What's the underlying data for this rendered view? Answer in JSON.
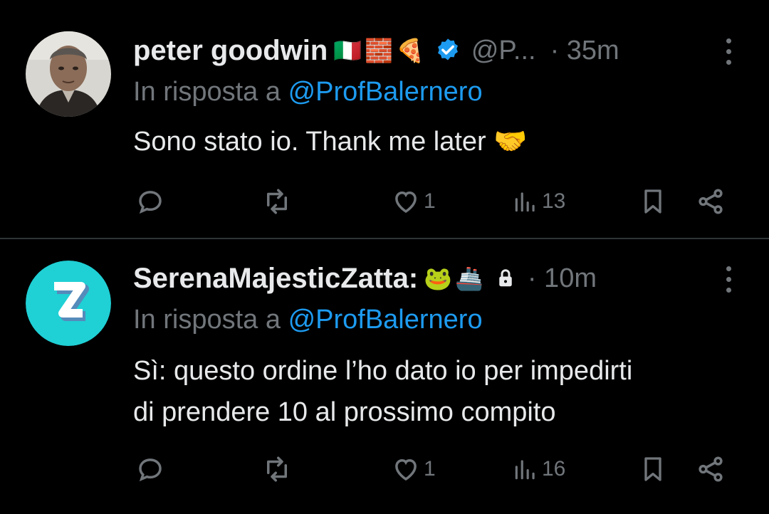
{
  "tweets": [
    {
      "name": "peter goodwin",
      "name_emojis": [
        "🇮🇹",
        "🧱",
        "🍕"
      ],
      "verified": true,
      "handle": "@P...",
      "time": "· 35m",
      "reply_prefix": "In risposta a",
      "reply_to": "@ProfBalernero",
      "text": "Sono stato io. Thank me later 🤝",
      "likes": "1",
      "views": "13",
      "avatar_icon": "man-portrait-icon"
    },
    {
      "name": "SerenaMajesticZatta:",
      "name_emojis": [
        "🐸",
        "🚢"
      ],
      "locked": true,
      "time": "· 10m",
      "reply_prefix": "In risposta a",
      "reply_to": "@ProfBalernero",
      "text_lines": [
        "Sì: questo ordine l’ho dato io per impedirti",
        "di prendere 10 al prossimo compito"
      ],
      "likes": "1",
      "views": "16",
      "avatar_letter": "Z",
      "avatar_color": "#1fd0d5"
    }
  ],
  "colors": {
    "accent": "#1d9bf0",
    "muted": "#71767b",
    "text": "#e7e9ea",
    "bg": "#000000"
  }
}
